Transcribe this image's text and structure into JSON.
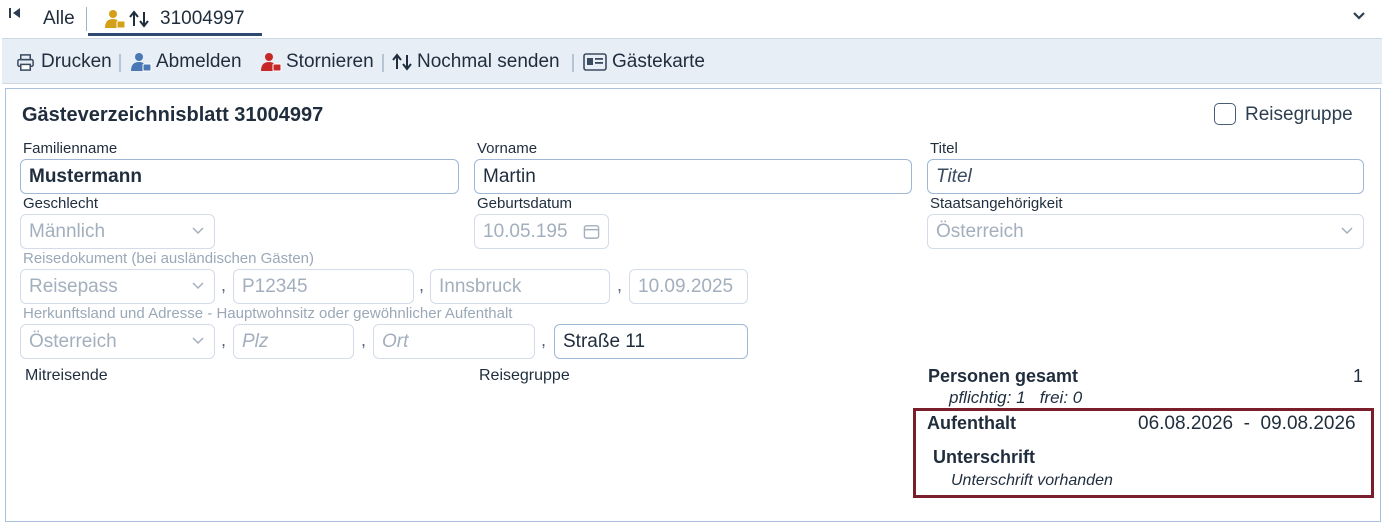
{
  "tabs": {
    "all_label": "Alle",
    "active_label": "31004997"
  },
  "toolbar": {
    "print": "Drucken",
    "checkout": "Abmelden",
    "cancel": "Stornieren",
    "resend": "Nochmal senden",
    "guestcard": "Gästekarte"
  },
  "form": {
    "title": "Gästeverzeichnisblatt 31004997",
    "travel_group_checkbox": "Reisegruppe",
    "labels": {
      "family_name": "Familienname",
      "first_name": "Vorname",
      "title": "Titel",
      "gender": "Geschlecht",
      "birthdate": "Geburtsdatum",
      "nationality": "Staatsangehörigkeit",
      "travel_doc": "Reisedokument (bei ausländischen Gästen)",
      "origin": "Herkunftsland und Adresse - Hauptwohnsitz oder gewöhnlicher Aufenthalt"
    },
    "values": {
      "family_name": "Mustermann",
      "first_name": "Martin",
      "title_placeholder": "Titel",
      "gender": "Männlich",
      "birthdate": "10.05.195",
      "nationality": "Österreich",
      "doc_type": "Reisepass",
      "doc_number": "P12345",
      "doc_authority": "Innsbruck",
      "doc_date": "10.09.2025",
      "country": "Österreich",
      "zip_placeholder": "Plz",
      "city_placeholder": "Ort",
      "street": "Straße 11"
    },
    "comma": ","
  },
  "sections": {
    "companions": "Mitreisende",
    "travel_group": "Reisegruppe"
  },
  "summary": {
    "persons_label": "Personen gesamt",
    "persons_value": "1",
    "persons_detail": "pflichtig: 1   frei: 0",
    "stay_label": "Aufenthalt",
    "stay_dates": "06.08.2026  -  09.08.2026",
    "signature_label": "Unterschrift",
    "signature_value": "Unterschrift vorhanden"
  },
  "colors": {
    "accent": "#2e4a72",
    "highlight_box": "#7a1e2c",
    "guest_icon": "#d4a017",
    "user_icon": "#4a78b5",
    "cancel_icon": "#c62828"
  },
  "icons": [
    "first-page-icon",
    "guest-icon",
    "sync-arrows-icon",
    "chevron-down-icon",
    "printer-icon",
    "user-checkout-icon",
    "user-cancel-icon",
    "resend-arrows-icon",
    "id-card-icon",
    "calendar-icon"
  ]
}
